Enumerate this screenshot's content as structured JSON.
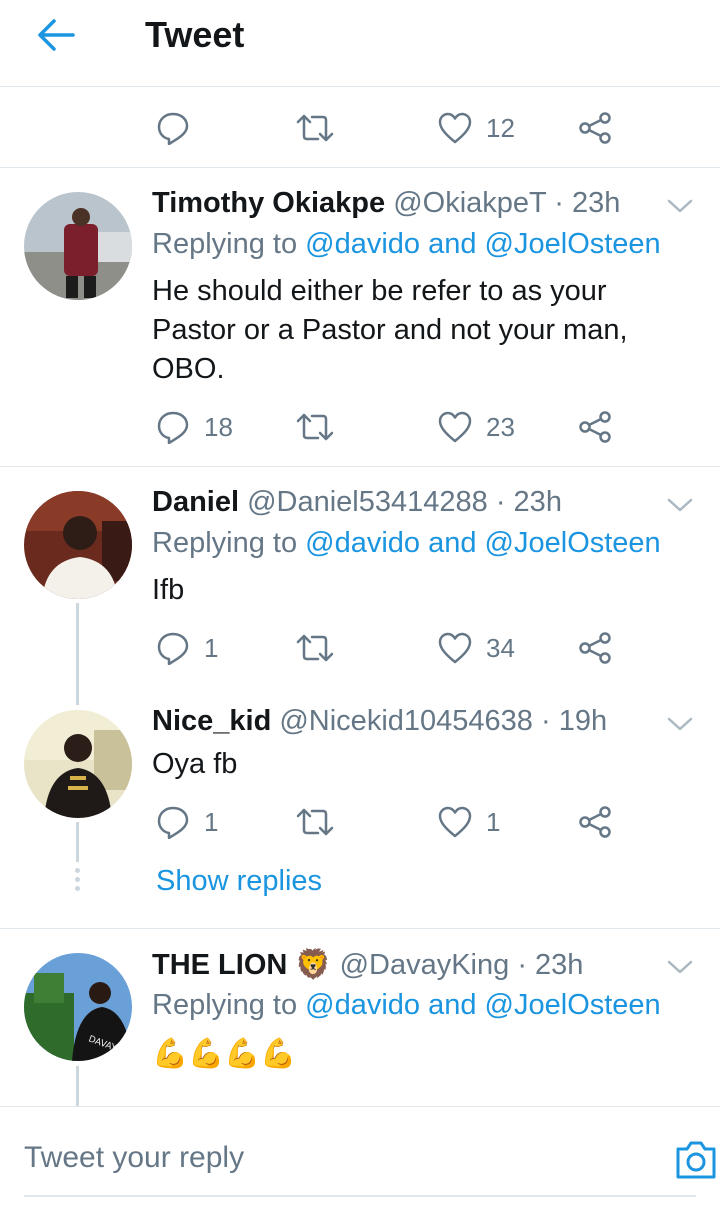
{
  "header": {
    "title": "Tweet"
  },
  "top_actions": {
    "like_count": "12"
  },
  "tweets": [
    {
      "name": "Timothy Okiakpe",
      "handle": "@OkiakpeT",
      "time": "· 23h",
      "replying_prefix": "Replying to",
      "replying_mentions": "@davido and @JoelOsteen",
      "text": "He should either be refer to as your Pastor or a Pastor and not your man, OBO.",
      "reply_count": "18",
      "like_count": "23"
    },
    {
      "name": "Daniel",
      "handle": "@Daniel53414288",
      "time": "· 23h",
      "replying_prefix": "Replying to",
      "replying_mentions": "@davido and @JoelOsteen",
      "text": "Ifb",
      "reply_count": "1",
      "like_count": "34"
    },
    {
      "name": "Nice_kid",
      "handle": "@Nicekid10454638",
      "time": "· 19h",
      "text": "Oya fb",
      "reply_count": "1",
      "like_count": "1"
    },
    {
      "name": "THE LION 🦁",
      "handle": "@DavayKing",
      "time": "· 23h",
      "replying_prefix": "Replying to",
      "replying_mentions": "@davido and @JoelOsteen",
      "text": "💪💪💪💪"
    }
  ],
  "show_replies_label": "Show replies",
  "reply_bar": {
    "placeholder": "Tweet your reply"
  },
  "colors": {
    "accent": "#1b95e0",
    "text": "#14171a",
    "secondary": "#657786",
    "border": "#e1e8ed"
  }
}
